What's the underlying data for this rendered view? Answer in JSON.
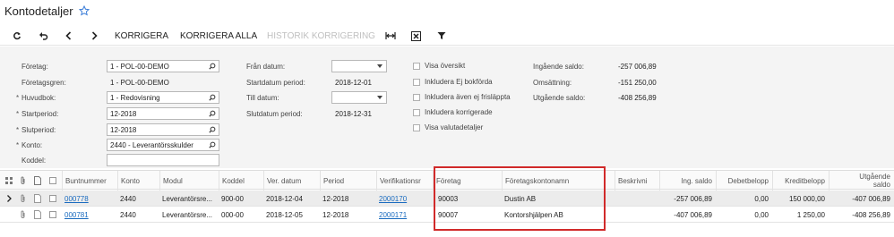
{
  "page": {
    "title": "Kontodetaljer"
  },
  "toolbar": {
    "korrigera": "KORRIGERA",
    "korrigera_alla": "KORRIGERA ALLA",
    "historik": "HISTORIK KORRIGERING"
  },
  "form": {
    "foretag_label": "Företag:",
    "foretag_value": "1 - POL-00-DEMO",
    "foretagsgren_label": "Företagsgren:",
    "foretagsgren_value": "1 - POL-00-DEMO",
    "huvudbok_label": "Huvudbok:",
    "huvudbok_value": "1 - Redovisning",
    "startperiod_label": "Startperiod:",
    "startperiod_value": "12-2018",
    "slutperiod_label": "Slutperiod:",
    "slutperiod_value": "12-2018",
    "konto_label": "Konto:",
    "konto_value": "2440 - Leverantörsskulder",
    "koddel_label": "Koddel:",
    "koddel_value": "",
    "fran_datum_label": "Från datum:",
    "startdatum_label": "Startdatum period:",
    "startdatum_value": "2018-12-01",
    "till_datum_label": "Till datum:",
    "slutdatum_label": "Slutdatum period:",
    "slutdatum_value": "2018-12-31",
    "cb_oversikt": "Visa översikt",
    "cb_ej_bokforda": "Inkludera Ej bokförda",
    "cb_frislappta": "Inkludera även ej frisläppta",
    "cb_korrigerade": "Inkludera korrigerade",
    "cb_valuta": "Visa valutadetaljer",
    "ingaende_label": "Ingående saldo:",
    "ingaende_value": "-257 006,89",
    "omsattning_label": "Omsättning:",
    "omsattning_value": "-151 250,00",
    "utgaende_label": "Utgående saldo:",
    "utgaende_value": "-408 256,89"
  },
  "grid": {
    "headers": {
      "buntnummer": "Buntnummer",
      "konto": "Konto",
      "modul": "Modul",
      "koddel": "Koddel",
      "ver_datum": "Ver. datum",
      "period": "Period",
      "verifikationsnr": "Verifikationsr",
      "foretag": "Företag",
      "foretagskontonamn": "Företagskontonamn",
      "beskrivning": "Beskrivni",
      "ing_saldo": "Ing. saldo",
      "debetbelopp": "Debetbelopp",
      "kreditbelopp": "Kreditbelopp",
      "utg_saldo_1": "Utgående",
      "utg_saldo_2": "saldo"
    },
    "rows": [
      {
        "buntnummer": "000778",
        "konto": "2440",
        "modul": "Leverantörsre...",
        "koddel": "900-00",
        "ver_datum": "2018-12-04",
        "period": "12-2018",
        "verifikationsnr": "2000170",
        "foretag": "90003",
        "foretagskontonamn": "Dustin AB",
        "beskrivning": "",
        "ing_saldo": "-257 006,89",
        "debetbelopp": "0,00",
        "kreditbelopp": "150 000,00",
        "utg_saldo": "-407 006,89"
      },
      {
        "buntnummer": "000781",
        "konto": "2440",
        "modul": "Leverantörsre...",
        "koddel": "000-00",
        "ver_datum": "2018-12-05",
        "period": "12-2018",
        "verifikationsnr": "2000171",
        "foretag": "90007",
        "foretagskontonamn": "Kontorshjälpen AB",
        "beskrivning": "",
        "ing_saldo": "-407 006,89",
        "debetbelopp": "0,00",
        "kreditbelopp": "1 250,00",
        "utg_saldo": "-408 256,89"
      }
    ]
  },
  "colors": {
    "link": "#1a6bbf",
    "highlight_box": "#d12a2a",
    "star": "#3b7dd8"
  }
}
